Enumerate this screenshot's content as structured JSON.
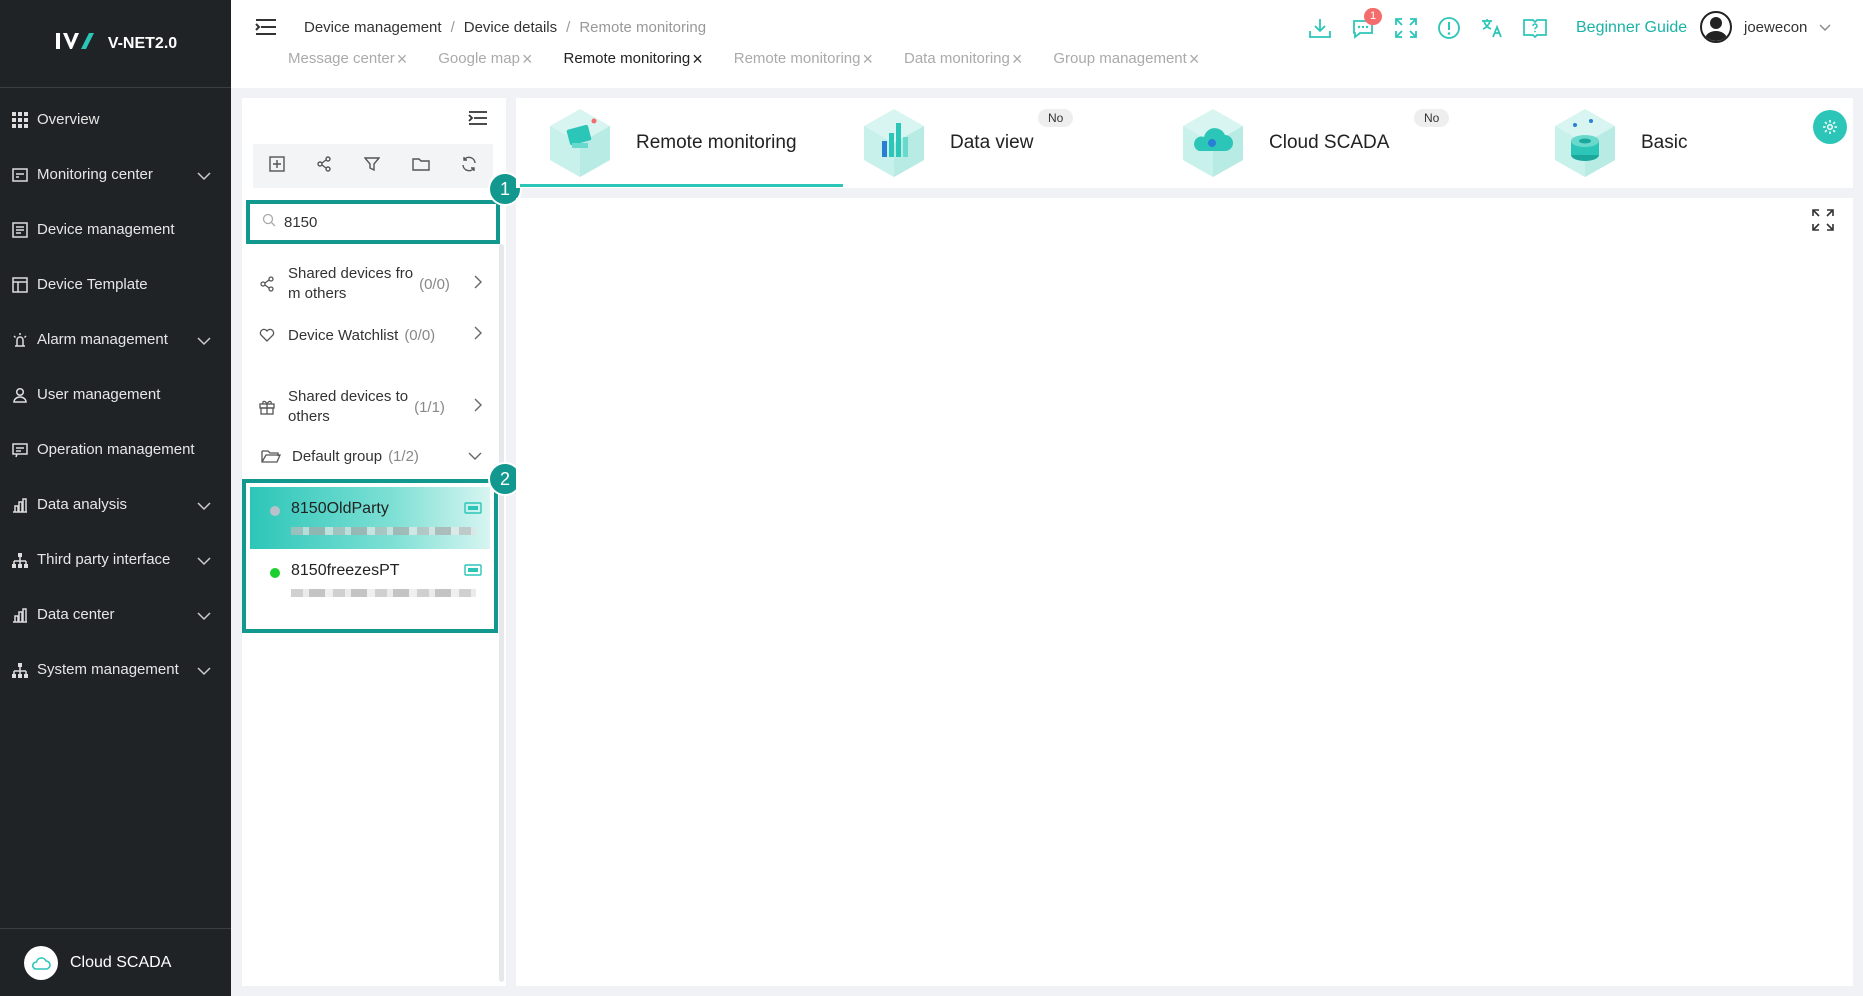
{
  "app": {
    "logo_text": "V-NET2.0",
    "accent": "#2cc6b8",
    "marker_color": "#13988f"
  },
  "sidebar": {
    "items": [
      {
        "label": "Overview",
        "icon": "grid-icon",
        "expandable": false
      },
      {
        "label": "Monitoring center",
        "icon": "monitor-icon",
        "expandable": true
      },
      {
        "label": "Device management",
        "icon": "device-icon",
        "expandable": false
      },
      {
        "label": "Device Template",
        "icon": "template-icon",
        "expandable": false
      },
      {
        "label": "Alarm management",
        "icon": "alarm-icon",
        "expandable": true
      },
      {
        "label": "User management",
        "icon": "user-icon",
        "expandable": false
      },
      {
        "label": "Operation management",
        "icon": "operation-icon",
        "expandable": false
      },
      {
        "label": "Data analysis",
        "icon": "chart-icon",
        "expandable": true
      },
      {
        "label": "Third party interface",
        "icon": "interface-icon",
        "expandable": true
      },
      {
        "label": "Data center",
        "icon": "data-center-icon",
        "expandable": true
      },
      {
        "label": "System management",
        "icon": "system-icon",
        "expandable": true
      }
    ],
    "bottom_label": "Cloud SCADA"
  },
  "header": {
    "breadcrumb": [
      "Device management",
      "Device details",
      "Remote monitoring"
    ],
    "notification_count": "1",
    "guide_label": "Beginner Guide",
    "username": "joewecon",
    "tabs": [
      {
        "label": "Message center",
        "active": false
      },
      {
        "label": "Google map",
        "active": false
      },
      {
        "label": "Remote monitoring",
        "active": true
      },
      {
        "label": "Remote monitoring",
        "active": false
      },
      {
        "label": "Data monitoring",
        "active": false
      },
      {
        "label": "Group management",
        "active": false
      }
    ]
  },
  "panel": {
    "search_value": "8150",
    "shared_from_others": {
      "label_line1": "Shared devices fro",
      "label_line2": "m others",
      "count": "(0/0)"
    },
    "watchlist": {
      "label": "Device Watchlist",
      "count": "(0/0)"
    },
    "shared_to_others": {
      "label_line1": "Shared devices to",
      "label_line2": "others",
      "count": "(1/1)"
    },
    "default_group": {
      "label": "Default group",
      "count": "(1/2)"
    },
    "devices": [
      {
        "name": "8150OldParty",
        "online": false,
        "selected": true
      },
      {
        "name": "8150freezesPT",
        "online": true,
        "selected": false
      }
    ]
  },
  "markers": [
    "1",
    "2"
  ],
  "modes": [
    {
      "label": "Remote monitoring",
      "badge": "",
      "active": true
    },
    {
      "label": "Data view",
      "badge": "No",
      "active": false
    },
    {
      "label": "Cloud SCADA",
      "badge": "No",
      "active": false
    },
    {
      "label": "Basic",
      "badge": "",
      "active": false
    }
  ]
}
